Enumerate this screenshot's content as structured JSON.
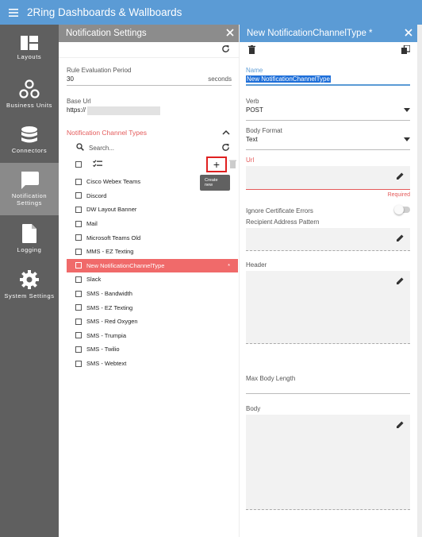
{
  "app": {
    "title": "2Ring Dashboards & Wallboards"
  },
  "sidebar": {
    "items": [
      {
        "label": "Layouts",
        "icon": "layouts-icon"
      },
      {
        "label": "Business Units",
        "icon": "business-units-icon"
      },
      {
        "label": "Connectors",
        "icon": "database-icon"
      },
      {
        "label": "Notification Settings",
        "icon": "notification-icon",
        "active": true
      },
      {
        "label": "Logging",
        "icon": "file-icon"
      },
      {
        "label": "System Settings",
        "icon": "gear-icon"
      }
    ]
  },
  "notification_settings": {
    "title": "Notification Settings",
    "rule_evaluation": {
      "label": "Rule Evaluation Period",
      "value": "30",
      "unit": "seconds"
    },
    "base_url": {
      "label": "Base Url",
      "value": "https://"
    },
    "channel_types": {
      "title": "Notification Channel Types",
      "search_placeholder": "Search...",
      "tooltip": "Create new",
      "add_label": "+",
      "items": [
        {
          "name": "Cisco Webex Teams"
        },
        {
          "name": "Discord"
        },
        {
          "name": "DW Layout Banner"
        },
        {
          "name": "Mail"
        },
        {
          "name": "Microsoft Teams Old"
        },
        {
          "name": "MMS - EZ Texting"
        },
        {
          "name": "New NotificationChannelType",
          "selected": true,
          "marker": "*"
        },
        {
          "name": "Slack"
        },
        {
          "name": "SMS - Bandwidth"
        },
        {
          "name": "SMS - EZ Texting"
        },
        {
          "name": "SMS - Red Oxygen"
        },
        {
          "name": "SMS - Trumpia"
        },
        {
          "name": "SMS - Twilio"
        },
        {
          "name": "SMS - Webtext"
        }
      ]
    }
  },
  "editor": {
    "title": "New NotificationChannelType *",
    "name": {
      "label": "Name",
      "value": "New NotificationChannelType"
    },
    "verb": {
      "label": "Verb",
      "value": "POST"
    },
    "body_format": {
      "label": "Body Format",
      "value": "Text"
    },
    "url": {
      "label": "Url",
      "value": "",
      "error": "Required"
    },
    "ignore_cert": {
      "label": "Ignore Certificate Errors",
      "checked": false
    },
    "recipient": {
      "label": "Recipient Address Pattern",
      "value": ""
    },
    "header": {
      "label": "Header",
      "value": ""
    },
    "max_body_length": {
      "label": "Max Body Length",
      "value": ""
    },
    "body": {
      "label": "Body",
      "value": ""
    }
  },
  "colors": {
    "primary": "#5b9bd5",
    "accent": "#e45b5b",
    "sidebar": "#5f5f5f",
    "selected_row": "#f06a6a"
  }
}
